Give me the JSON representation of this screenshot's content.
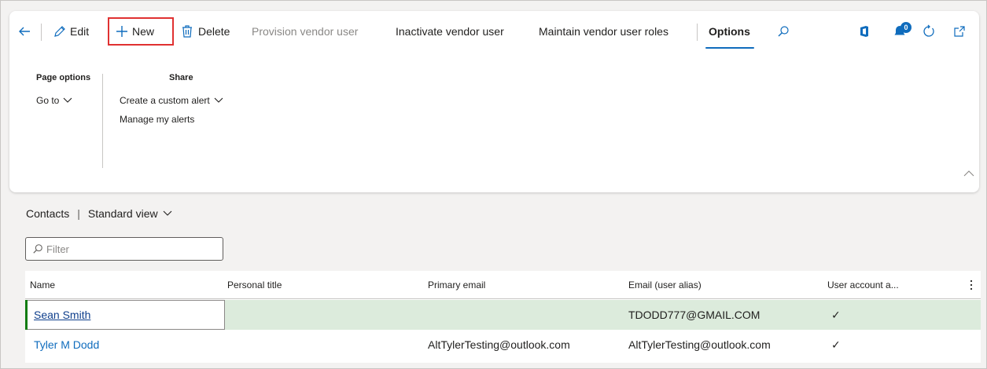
{
  "toolbar": {
    "edit_label": "Edit",
    "new_label": "New",
    "delete_label": "Delete",
    "provision_label": "Provision vendor user",
    "inactivate_label": "Inactivate vendor user",
    "maintain_label": "Maintain vendor user roles",
    "options_label": "Options",
    "notifications_count": "0"
  },
  "options_pane": {
    "page_options_title": "Page options",
    "goto_label": "Go to",
    "share_title": "Share",
    "custom_alert_label": "Create a custom alert",
    "manage_alerts_label": "Manage my alerts"
  },
  "view": {
    "entity": "Contacts",
    "view_name": "Standard view",
    "filter_placeholder": "Filter"
  },
  "grid": {
    "columns": [
      "Name",
      "Personal title",
      "Primary email",
      "Email (user alias)",
      "User account a..."
    ],
    "rows": [
      {
        "name": "Sean Smith",
        "personal_title": "",
        "primary_email": "",
        "user_alias": "TDODD777@GMAIL.COM",
        "user_account": "✓"
      },
      {
        "name": "Tyler M Dodd",
        "personal_title": "",
        "primary_email": "AltTylerTesting@outlook.com",
        "user_alias": "AltTylerTesting@outlook.com",
        "user_account": "✓"
      }
    ]
  },
  "colors": {
    "accent": "#0f6cbd",
    "highlight_box": "#e03131",
    "selected_row": "#dcebdc",
    "selected_bar": "#107c10"
  }
}
